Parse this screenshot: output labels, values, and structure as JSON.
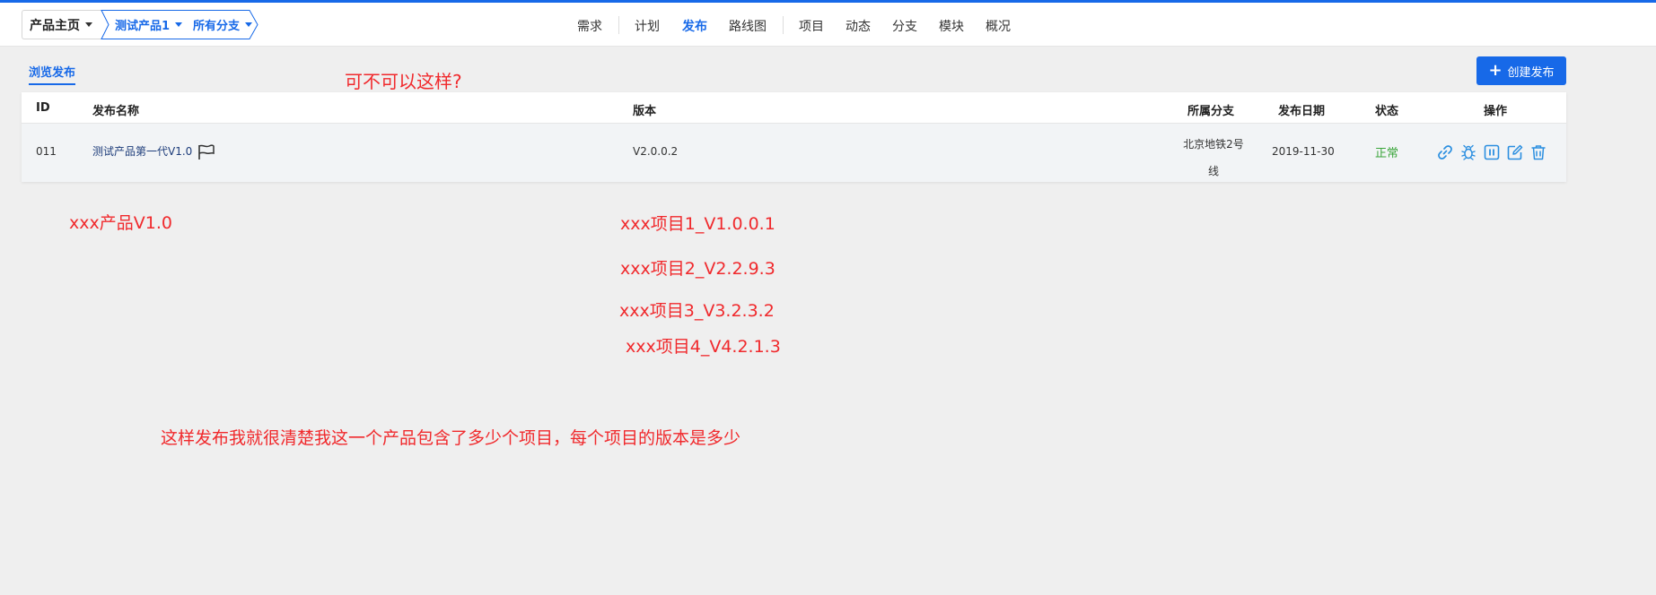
{
  "header": {
    "home_label": "产品主页",
    "product_label": "测试产品1",
    "branch_label": "所有分支",
    "nav": [
      {
        "label": "需求",
        "active": false
      },
      {
        "label": "计划",
        "active": false
      },
      {
        "label": "发布",
        "active": true
      },
      {
        "label": "路线图",
        "active": false
      },
      {
        "label": "项目",
        "active": false
      },
      {
        "label": "动态",
        "active": false
      },
      {
        "label": "分支",
        "active": false
      },
      {
        "label": "模块",
        "active": false
      },
      {
        "label": "概况",
        "active": false
      }
    ]
  },
  "toolbar": {
    "tab_label": "浏览发布",
    "create_label": "创建发布"
  },
  "table": {
    "columns": [
      "ID",
      "发布名称",
      "版本",
      "所属分支",
      "发布日期",
      "状态",
      "操作"
    ],
    "row": {
      "id": "011",
      "name": "测试产品第一代V1.0",
      "version": "V2.0.0.2",
      "branch_line1": "北京地铁2号",
      "branch_line2": "线",
      "date": "2019-11-30",
      "status": "正常"
    },
    "actions": [
      "link-icon",
      "bug-icon",
      "pause-icon",
      "edit-icon",
      "delete-icon"
    ]
  },
  "annotations": {
    "question": "可不可以这样?",
    "product": "xxx产品V1.0",
    "items": [
      "xxx项目1_V1.0.0.1",
      "xxx项目2_V2.2.9.3",
      "xxx项目3_V3.2.3.2",
      "xxx项目4_V4.2.1.3"
    ],
    "summary": "这样发布我就很清楚我这一个产品包含了多少个项目，每个项目的版本是多少"
  },
  "colors": {
    "accent": "#1769e8",
    "annotation": "#f0292c",
    "status_ok": "#3aa53a"
  }
}
